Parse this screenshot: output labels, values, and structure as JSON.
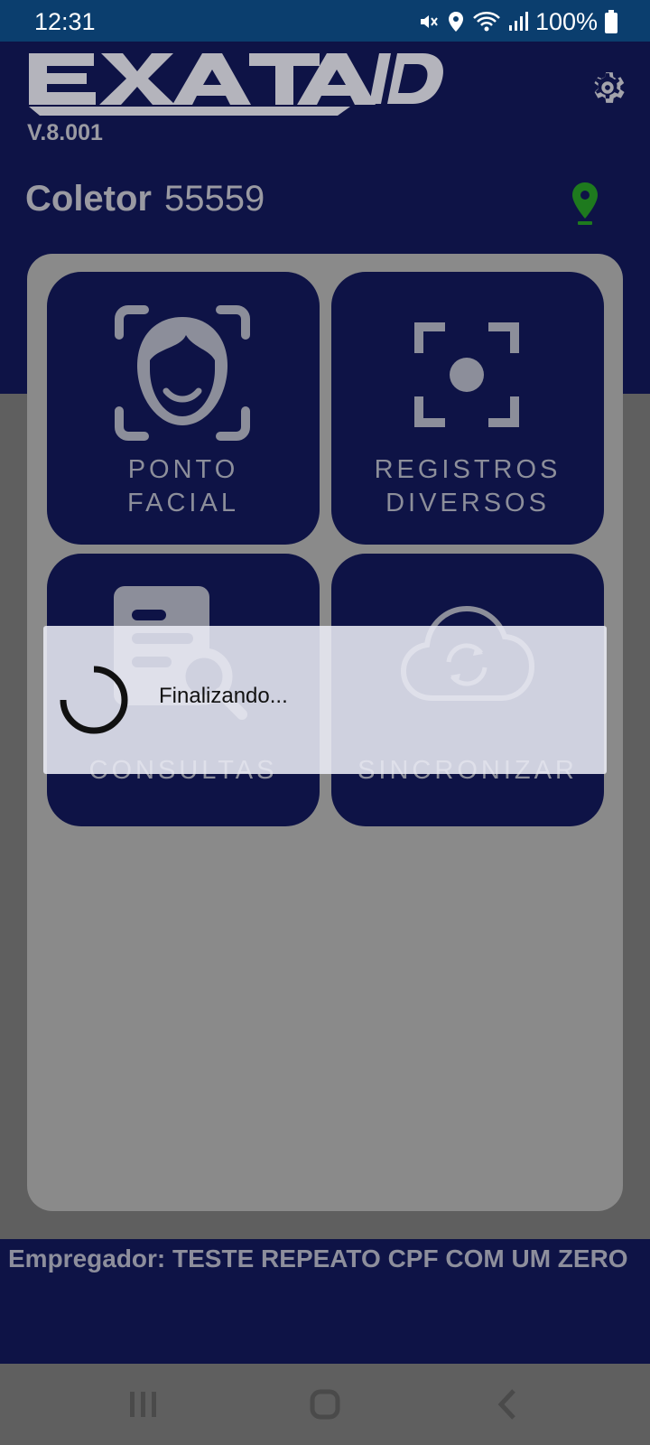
{
  "status_bar": {
    "time": "12:31",
    "battery": "100%",
    "icons": [
      "mute-icon",
      "location-icon",
      "wifi-icon",
      "signal-icon",
      "battery-icon"
    ]
  },
  "header": {
    "logo_text": "EXATA ID",
    "version": "V.8.001",
    "collector_label": "Coletor",
    "collector_value": "55559"
  },
  "tiles": [
    {
      "label_line1": "PONTO",
      "label_line2": "FACIAL",
      "icon": "face-scan-icon"
    },
    {
      "label_line1": "REGISTROS",
      "label_line2": "DIVERSOS",
      "icon": "focus-dot-icon"
    },
    {
      "label_line1": "CONSULTAS",
      "label_line2": "",
      "icon": "document-search-icon"
    },
    {
      "label_line1": "SINCRONIZAR",
      "label_line2": "",
      "icon": "cloud-sync-icon"
    }
  ],
  "footer": {
    "employer": "Empregador: TESTE REPEATO CPF COM UM ZERO"
  },
  "dialog": {
    "message": "Finalizando..."
  },
  "colors": {
    "status_bar": "#0b3e6e",
    "brand_navy": "#0e1346",
    "location_green": "#1e7a1e"
  },
  "navbar": {
    "icons": [
      "recents-icon",
      "home-icon",
      "back-icon"
    ]
  }
}
